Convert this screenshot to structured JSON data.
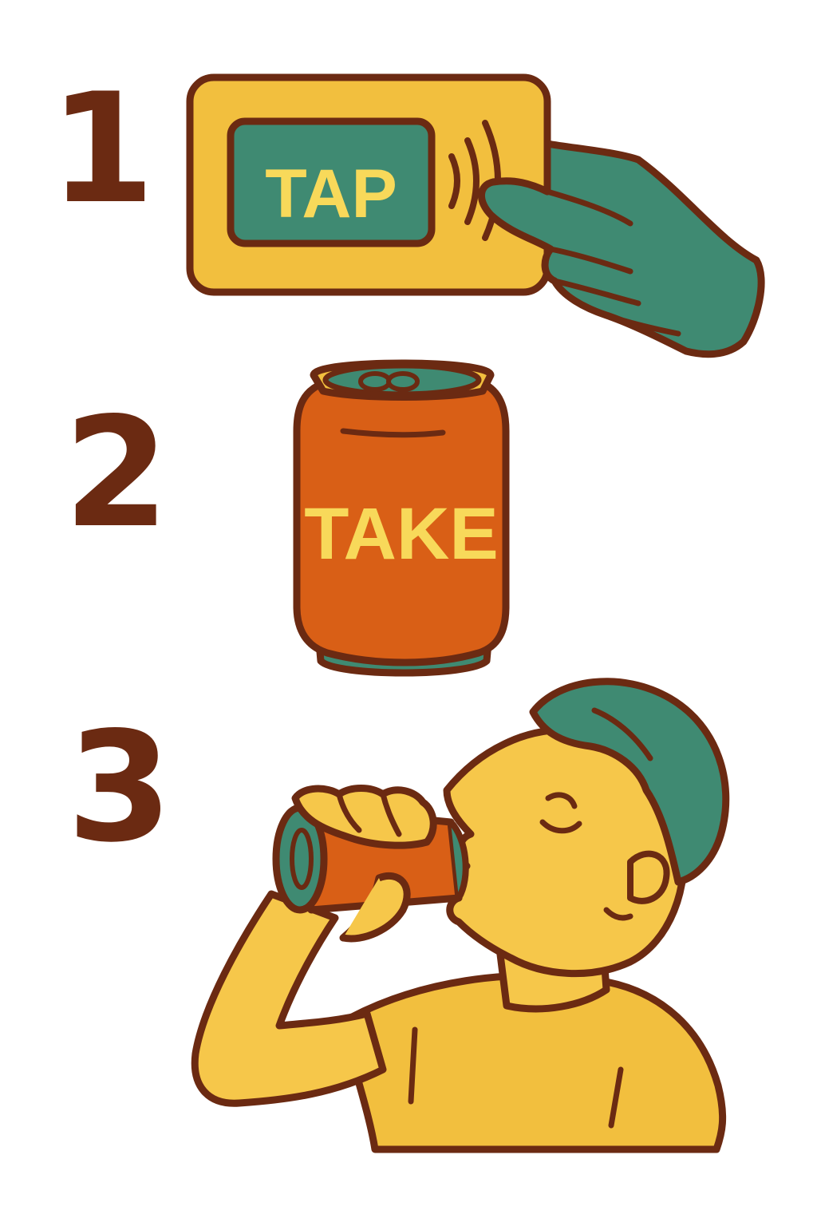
{
  "steps": [
    {
      "number": "1",
      "label": "TAP",
      "icon": "tap-card-icon"
    },
    {
      "number": "2",
      "label": "TAKE",
      "icon": "soda-can-icon"
    },
    {
      "number": "3",
      "label": "",
      "icon": "person-drinking-icon"
    }
  ],
  "colors": {
    "outline": "#6b2a12",
    "yellow": "#f2bf3e",
    "teal": "#3f8a72",
    "orange": "#d95f16",
    "label_yellow": "#f8d95a",
    "skin": "#f6c74a",
    "background": "#ffffff"
  }
}
